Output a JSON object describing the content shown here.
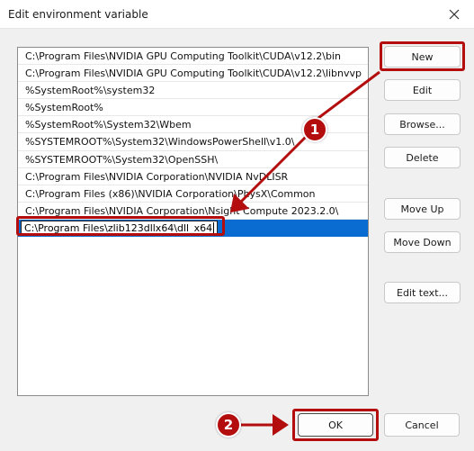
{
  "window": {
    "title": "Edit environment variable"
  },
  "list": {
    "items": [
      {
        "text": "C:\\Program Files\\NVIDIA GPU Computing Toolkit\\CUDA\\v12.2\\bin"
      },
      {
        "text": "C:\\Program Files\\NVIDIA GPU Computing Toolkit\\CUDA\\v12.2\\libnvvp"
      },
      {
        "text": "%SystemRoot%\\system32"
      },
      {
        "text": "%SystemRoot%"
      },
      {
        "text": "%SystemRoot%\\System32\\Wbem"
      },
      {
        "text": "%SYSTEMROOT%\\System32\\WindowsPowerShell\\v1.0\\"
      },
      {
        "text": "%SYSTEMROOT%\\System32\\OpenSSH\\"
      },
      {
        "text": "C:\\Program Files\\NVIDIA Corporation\\NVIDIA NvDLISR"
      },
      {
        "text": "C:\\Program Files (x86)\\NVIDIA Corporation\\PhysX\\Common"
      },
      {
        "text": "C:\\Program Files\\NVIDIA Corporation\\Nsight Compute 2023.2.0\\"
      }
    ],
    "editing_value": "C:\\Program Files\\zlib123dllx64\\dll_x64"
  },
  "buttons": {
    "new": "New",
    "edit": "Edit",
    "browse": "Browse...",
    "delete": "Delete",
    "move_up": "Move Up",
    "move_down": "Move Down",
    "edit_text": "Edit text...",
    "ok": "OK",
    "cancel": "Cancel"
  },
  "annotations": {
    "step1": "1",
    "step2": "2",
    "color": "#b30d0d"
  },
  "icons": {
    "close": "close-icon"
  }
}
